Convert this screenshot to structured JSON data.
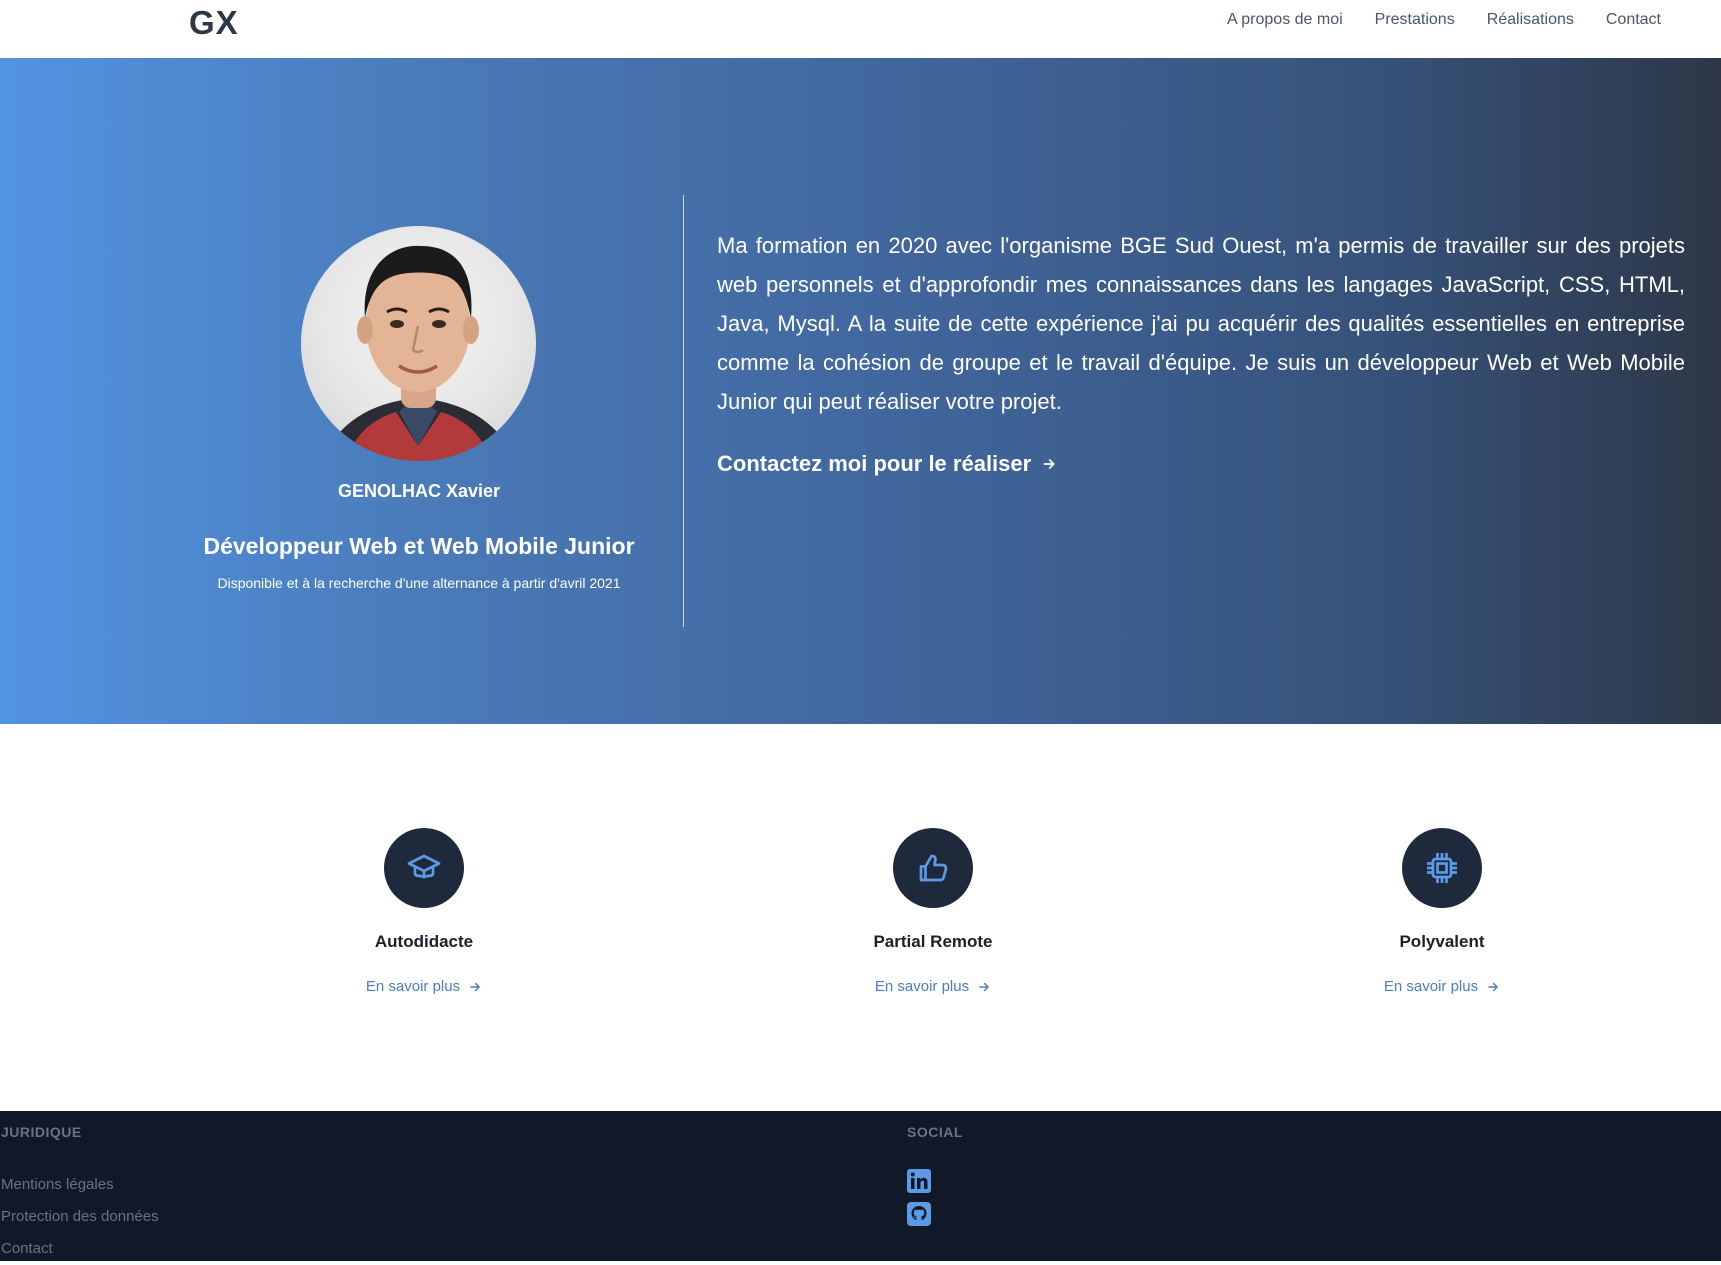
{
  "header": {
    "logo": "GX",
    "nav": [
      "A propos de moi",
      "Prestations",
      "Réalisations",
      "Contact"
    ]
  },
  "hero": {
    "name": "GENOLHAC Xavier",
    "role": "Développeur Web et Web Mobile Junior",
    "availability": "Disponible et à la recherche d'une alternance à partir d'avril 2021",
    "bio": "Ma formation en 2020 avec l'organisme BGE Sud Ouest, m'a permis de travailler sur des projets web personnels et d'approfondir mes connaissances dans les langages JavaScript, CSS, HTML, Java, Mysql. A la suite de cette expérience j'ai pu acquérir des qualités essentielles en entreprise comme la cohésion de groupe et le travail d'équipe. Je suis un développeur Web et Web Mobile Junior qui peut réaliser votre projet.",
    "cta": "Contactez moi pour le réaliser"
  },
  "features": [
    {
      "title": "Autodidacte",
      "link": "En savoir plus",
      "icon": "graduation-cap-icon"
    },
    {
      "title": "Partial Remote",
      "link": "En savoir plus",
      "icon": "thumbs-up-icon"
    },
    {
      "title": "Polyvalent",
      "link": "En savoir plus",
      "icon": "cpu-chip-icon"
    }
  ],
  "footer": {
    "legal_title": "JURIDIQUE",
    "legal_links": [
      "Mentions légales",
      "Protection des données",
      "Contact"
    ],
    "social_title": "SOCIAL",
    "social_icons": [
      "linkedin-icon",
      "github-icon"
    ]
  },
  "colors": {
    "hero_gradient_start": "#5294e2",
    "hero_gradient_end": "#2d3748",
    "accent": "#4a7ec2",
    "icon_blue": "#5b9be6",
    "dark": "#1e293b",
    "footer_bg": "#111827"
  }
}
